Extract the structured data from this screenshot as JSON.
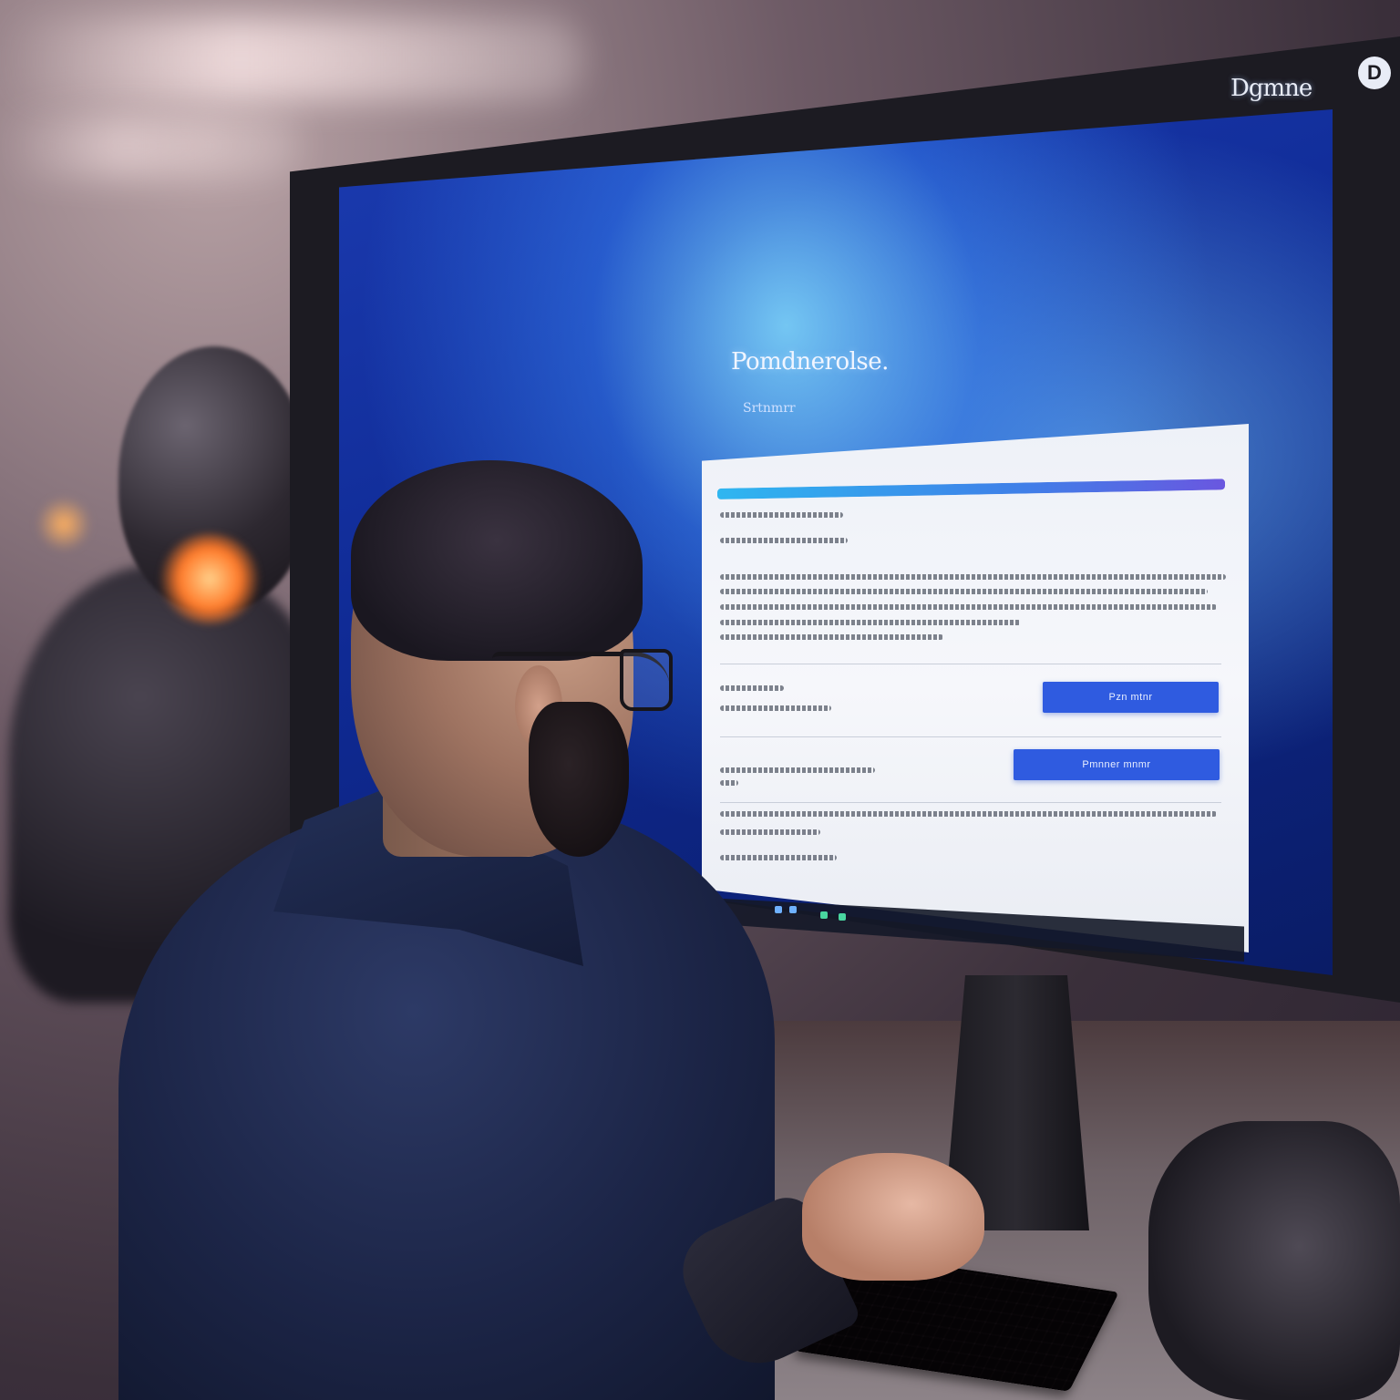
{
  "monitor": {
    "brand_text": "Dgmne",
    "brand_mark": "D"
  },
  "screen": {
    "title": "Pomdnerolse.",
    "subtitle": "Srtnmrr"
  },
  "dialog": {
    "progress": 1.0,
    "primary_button": "Pzn mtnr",
    "secondary_button": "Pmnner mnmr"
  },
  "colors": {
    "screen_background": "#1b3bb0",
    "panel_background": "#eef1f8",
    "button_blue": "#2f5be0",
    "progress_start": "#2fb6f0",
    "progress_end": "#6a57e0"
  },
  "icons": {
    "brand_mark": "brand-logo-icon"
  }
}
